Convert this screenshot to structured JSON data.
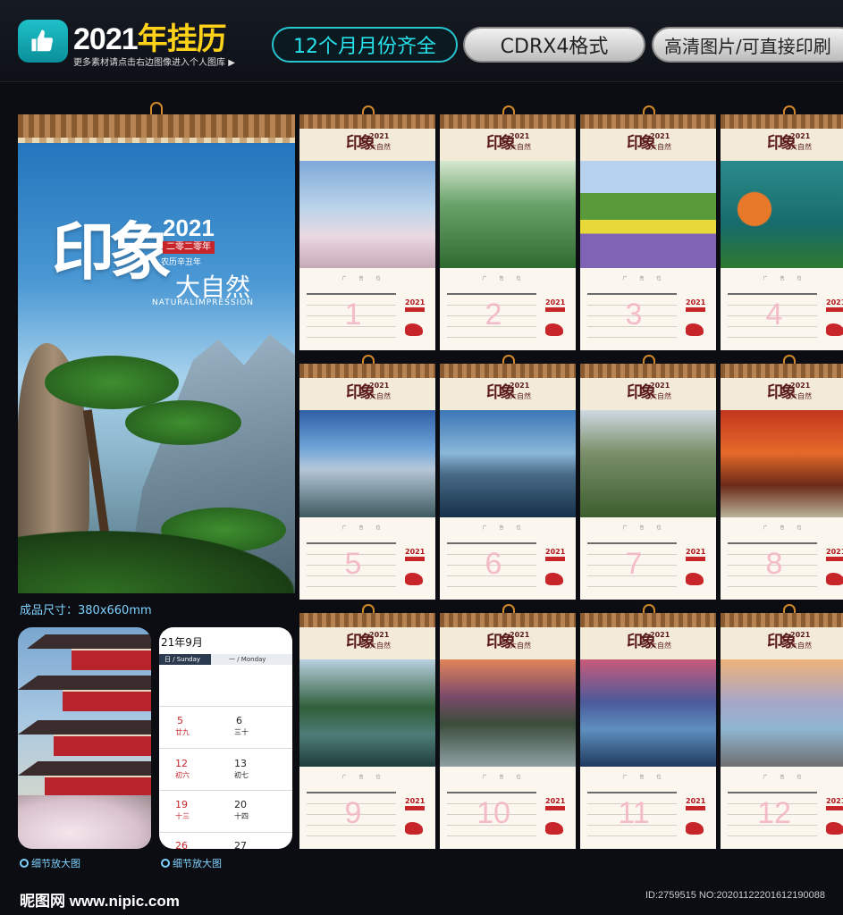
{
  "header": {
    "title_year": "2021",
    "title_text": "年挂历",
    "subtitle": "更多素材请点击右边图像进入个人图库",
    "pill_months": "12个月月份齐全",
    "pill_format": "CDRX4格式",
    "pill_hd": "高清图片/可直接印刷",
    "thumb_icon": "thumbs-up-icon"
  },
  "cover": {
    "title_yin": "印象",
    "year": "2021",
    "red_band": "二零二零年",
    "lunar": "农历辛丑年",
    "subtitle_dzr": "大自然",
    "english": "NATURALIMPRESSION"
  },
  "size_label": "成品尺寸：380x660mm",
  "detail": {
    "caption_a": "细节放大图",
    "caption_b": "细节放大图",
    "cal_title": "21年9月",
    "col_sun": "日 / Sunday",
    "col_mon": "一 / Monday",
    "rows": [
      {
        "sun": "5",
        "sun_lunar": "廿九",
        "mon": "6",
        "mon_lunar": "三十"
      },
      {
        "sun": "12",
        "sun_lunar": "初六",
        "mon": "13",
        "mon_lunar": "初七"
      },
      {
        "sun": "19",
        "sun_lunar": "十三",
        "mon": "20",
        "mon_lunar": "十四"
      },
      {
        "sun": "26",
        "sun_lunar": "",
        "mon": "27",
        "mon_lunar": ""
      }
    ]
  },
  "month_header": {
    "yin": "印象",
    "year": "2021",
    "dzr": "大自然",
    "ad": "广告位"
  },
  "months": [
    {
      "num": "1"
    },
    {
      "num": "2"
    },
    {
      "num": "3"
    },
    {
      "num": "4"
    },
    {
      "num": "5"
    },
    {
      "num": "6"
    },
    {
      "num": "7"
    },
    {
      "num": "8"
    },
    {
      "num": "9"
    },
    {
      "num": "10"
    },
    {
      "num": "11"
    },
    {
      "num": "12"
    }
  ],
  "footer": {
    "site": "昵图网 www.nipic.com",
    "id": "ID:2759515 NO:20201122201612190088"
  }
}
